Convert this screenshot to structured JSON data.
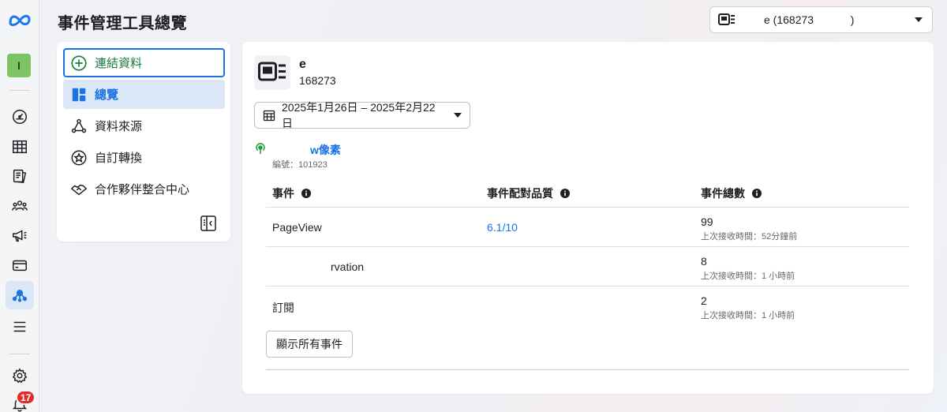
{
  "header": {
    "title": "事件管理工具總覽",
    "account_selector": {
      "label": "e (168273            )",
      "icon": "dataset-icon"
    }
  },
  "rail": {
    "account_initial": "I",
    "notifications_count": "17",
    "items": [
      {
        "icon": "meta-logo"
      },
      {
        "icon": "dashboard-gauge-icon"
      },
      {
        "icon": "table-icon"
      },
      {
        "icon": "catalog-icon"
      },
      {
        "icon": "audience-icon"
      },
      {
        "icon": "megaphone-icon"
      },
      {
        "icon": "billing-card-icon"
      },
      {
        "icon": "events-manager-icon",
        "active": true
      },
      {
        "icon": "menu-icon"
      },
      {
        "icon": "settings-gear-icon"
      },
      {
        "icon": "bell-icon"
      }
    ]
  },
  "nav": {
    "items": [
      {
        "label": "連結資料",
        "icon": "plus-circle-icon"
      },
      {
        "label": "總覽",
        "icon": "overview-icon",
        "selected": true
      },
      {
        "label": "資料來源",
        "icon": "data-sources-icon"
      },
      {
        "label": "自訂轉換",
        "icon": "star-badge-icon"
      },
      {
        "label": "合作夥伴整合中心",
        "icon": "handshake-icon"
      }
    ]
  },
  "main": {
    "dataset": {
      "name": "e",
      "id": "168273"
    },
    "date_range": "2025年1月26日 – 2025年2月22日",
    "pixel": {
      "name": "w像素",
      "id_label": "編號：101923",
      "status_color": "#1e9e3a"
    },
    "table": {
      "headers": [
        "事件",
        "事件配對品質",
        "事件總數"
      ],
      "rows": [
        {
          "event": "PageView",
          "quality": "6.1/10",
          "count": "99",
          "last": "上次接收時間：52分鐘前"
        },
        {
          "event": "rvation",
          "quality": "",
          "count": "8",
          "last": "上次接收時間：1 小時前"
        },
        {
          "event": "訂閱",
          "quality": "",
          "count": "2",
          "last": "上次接收時間：1 小時前"
        }
      ]
    },
    "show_all_label": "顯示所有事件"
  },
  "colors": {
    "accent": "#1b74e4",
    "selected_bg": "#dbe7f7",
    "connect_text": "#1a7a3d",
    "badge_red": "#e02a2a"
  }
}
